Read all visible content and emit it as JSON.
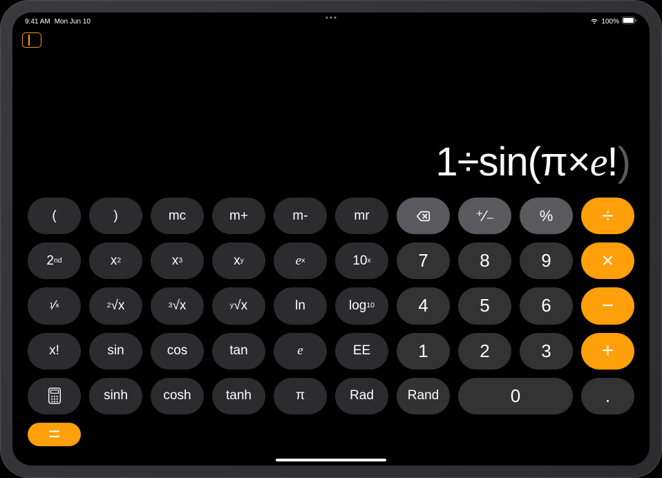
{
  "status": {
    "time": "9:41 AM",
    "date": "Mon Jun 10",
    "battery_pct": "100%"
  },
  "display": {
    "expr_prefix": "1÷sin(π×",
    "expr_e": "e",
    "expr_bang": "!",
    "expr_close": ")"
  },
  "keys": {
    "r1": {
      "lparen": "(",
      "rparen": ")",
      "mc": "mc",
      "mplus": "m+",
      "mminus": "m-",
      "mr": "mr",
      "plusminus": "⁺∕₋",
      "percent": "%",
      "divide": "÷"
    },
    "r2": {
      "second": "2",
      "second_sup": "nd",
      "x2_b": "x",
      "x2_s": "2",
      "x3_b": "x",
      "x3_s": "3",
      "xy_b": "x",
      "xy_s": "y",
      "ex_b": "e",
      "ex_s": "x",
      "tenx_b": "10",
      "tenx_s": "x",
      "n7": "7",
      "n8": "8",
      "n9": "9",
      "multiply": "×"
    },
    "r3": {
      "inv_t": "1",
      "inv_b": "x",
      "root2_s": "2",
      "root2_r": "√x",
      "root3_s": "3",
      "root3_r": "√x",
      "rooty_s": "y",
      "rooty_r": "√x",
      "ln": "ln",
      "log_b": "log",
      "log_s": "10",
      "n4": "4",
      "n5": "5",
      "n6": "6",
      "minus": "−"
    },
    "r4": {
      "fact": "x!",
      "sin": "sin",
      "cos": "cos",
      "tan": "tan",
      "e": "e",
      "ee": "EE",
      "n1": "1",
      "n2": "2",
      "n3": "3",
      "plus": "+"
    },
    "r5": {
      "sinh": "sinh",
      "cosh": "cosh",
      "tanh": "tanh",
      "pi": "π",
      "rad": "Rad",
      "rand": "Rand",
      "n0": "0",
      "dot": ".",
      "equals": "="
    }
  }
}
